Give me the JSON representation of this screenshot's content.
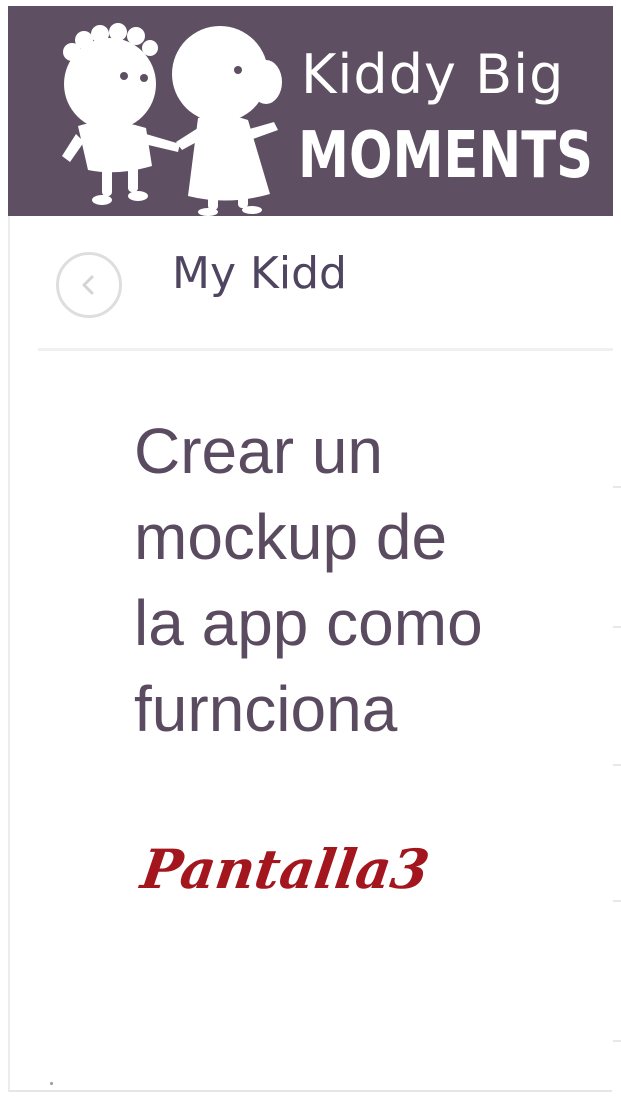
{
  "header": {
    "brand_line1": "Kiddy Big",
    "brand_line2": "MOMENTS",
    "illustration_icon": "kids-silhouette-logo",
    "background_color": "#5e4f63"
  },
  "nav": {
    "back_icon": "chevron-left-icon",
    "title": "My Kidd"
  },
  "main": {
    "lines": [
      "Crear un",
      "mockup de",
      "la app como",
      "furnciona"
    ],
    "screen_label": "Pantalla3",
    "text_color": "#5a4b61",
    "label_color": "#a4161e"
  }
}
